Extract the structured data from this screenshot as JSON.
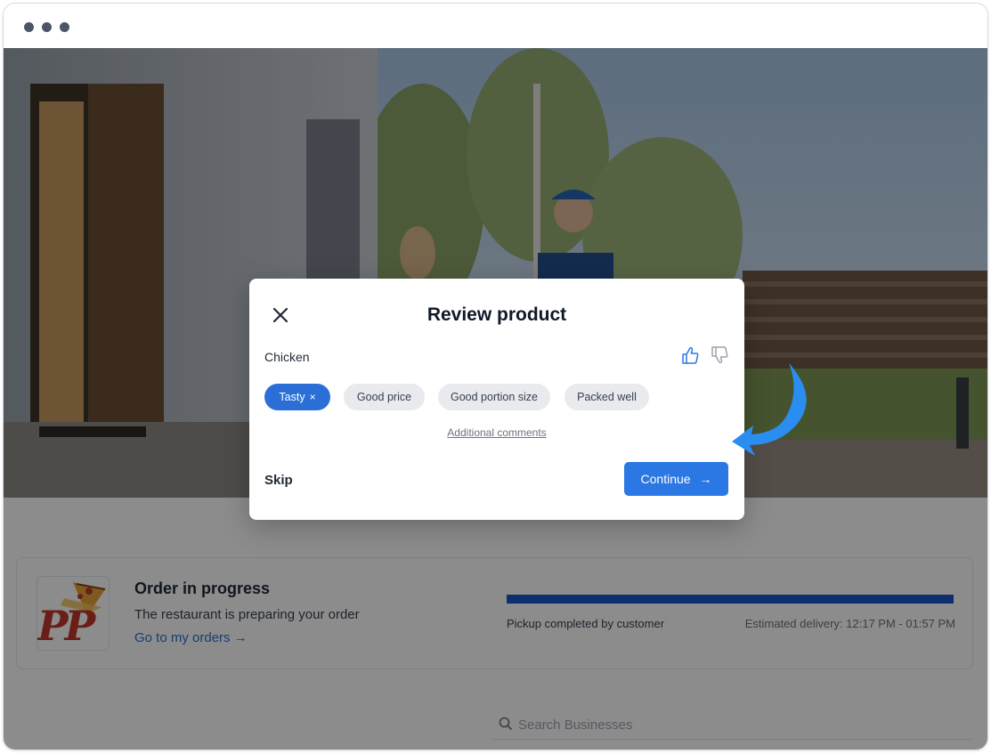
{
  "window": {
    "dots": [
      "dot-1",
      "dot-2",
      "dot-3"
    ]
  },
  "modal": {
    "title": "Review product",
    "product": "Chicken",
    "chips": [
      {
        "label": "Tasty",
        "selected": true,
        "remove": "×"
      },
      {
        "label": "Good price",
        "selected": false
      },
      {
        "label": "Good portion size",
        "selected": false
      },
      {
        "label": "Packed well",
        "selected": false
      }
    ],
    "additional_comments": "Additional comments",
    "skip": "Skip",
    "continue": "Continue",
    "continue_arrow": "→",
    "icons": [
      "close-icon",
      "thumbs-up-icon",
      "thumbs-down-icon"
    ]
  },
  "order": {
    "logo_text": "PP",
    "title": "Order in progress",
    "subtitle": "The restaurant is preparing your order",
    "link": "Go to my orders →",
    "progress": 1.0,
    "status": "Pickup completed by customer",
    "eta": "Estimated delivery: 12:17 PM - 01:57 PM"
  },
  "search": {
    "placeholder": "Search Businesses"
  },
  "colors": {
    "accent": "#2b77e3",
    "progress": "#1a56c9",
    "annotation_arrow": "#2a8df0"
  }
}
